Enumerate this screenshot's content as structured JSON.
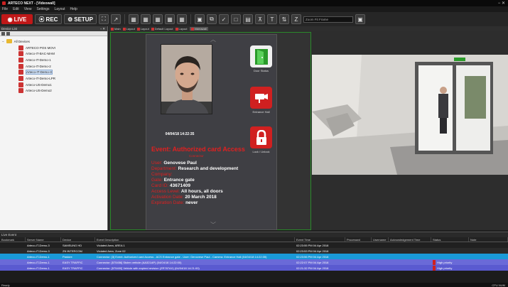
{
  "window": {
    "title": "ARTECO NEXT - [Videowall]",
    "controls": "− ✕"
  },
  "menu": [
    "File",
    "Edit",
    "View",
    "Settings",
    "Layout",
    "Help"
  ],
  "toolbar": {
    "live": "LIVE",
    "rec": "REC",
    "setup": "SETUP",
    "zoom_placeholder": "Zoom Fit Frame"
  },
  "device_list": {
    "title": "Device List",
    "pin": "▫ ✕",
    "root": "All Devices",
    "items": [
      {
        "label": "ARTECO POS MOVI"
      },
      {
        "label": "Arteco-IT-BAC-MAM"
      },
      {
        "label": "Arteco-IT-Demo-1"
      },
      {
        "label": "Arteco-IT-Demo-2"
      },
      {
        "label": "Arteco-IT-Demo-3",
        "selected": true
      },
      {
        "label": "Arteco-IT-Demo-LPR"
      },
      {
        "label": "Arteco-US-Demo1"
      },
      {
        "label": "Arteco-US-Demo2"
      }
    ]
  },
  "tabs": [
    {
      "label": "Main"
    },
    {
      "label": "Layout"
    },
    {
      "label": "Layout"
    },
    {
      "label": "Default Layout"
    },
    {
      "label": "Layout"
    },
    {
      "label": "Videowall",
      "active": true
    }
  ],
  "event_card": {
    "timestamp": "04/04/18 14:22:35",
    "title": "Event: Authorized card Access",
    "subtitle": "Connector",
    "rows": [
      {
        "key": "User:",
        "value": "Genovese Paul"
      },
      {
        "key": "Department:",
        "value": "Research and development"
      },
      {
        "key": "Company:",
        "value": ""
      },
      {
        "key": "Gate:",
        "value": "Entrance gate"
      },
      {
        "key": "Card ID:",
        "value": "43671409"
      },
      {
        "key": "Access Level:",
        "value": "All hours, all doors"
      },
      {
        "key": "Activation Date:",
        "value": "20 March 2018"
      },
      {
        "key": "Expiration Date:",
        "value": "never"
      }
    ],
    "buttons": [
      {
        "label": "Door Status",
        "icon": "door-icon"
      },
      {
        "label": "Entrance Hall",
        "icon": "camera-icon"
      },
      {
        "label": "Lock / Unlock",
        "icon": "lock-icon"
      }
    ]
  },
  "live_event": {
    "title": "Live Event",
    "columns": [
      "Bookmark",
      "Server Name",
      "Device",
      "Event Description",
      "Event Time",
      "Processed",
      "Username",
      "Acknowledgement Time",
      "Status",
      "Note"
    ],
    "rows": [
      {
        "server": "Arteco-IT-Demo-3",
        "device": "SAMSUNG HD",
        "desc": "Violated Area, AREA 1",
        "time": "02:23:55 PM 04 Apr 2018",
        "status": ""
      },
      {
        "server": "Arteco-IT-Demo-3",
        "device": "ZN INTERCOM",
        "desc": "Violated Area, Zone 02",
        "time": "02:23:53 PM 04 Apr 2018",
        "status": ""
      },
      {
        "server": "Arteco-IT-Demo-1",
        "device": "Pastore",
        "desc": "Connector: [3] Event: Authorized card Access - ACS Entrance gate - User: Genovese Paul - Camera: Entrance Hall (04/04/18 14:22:35)",
        "time": "02:23:56 PM 04 Apr 2018",
        "status": ""
      },
      {
        "server": "Arteco-IT-Demo-1",
        "device": "EASY TRAFFIC",
        "desc": "Connector: [575456] Stolen vehicle (AA321AP) (04/04/18 14:22:00)",
        "time": "02:22:07 PM 04 Apr 2018",
        "status": "High priority"
      },
      {
        "server": "Arteco-IT-Demo-1",
        "device": "EASY TRAFFIC",
        "desc": "Connector: [575400] Vehicle with expired revision (ZR787AX) (04/04/18 14:21:00)",
        "time": "02:21:32 PM 04 Apr 2018",
        "status": "High priority"
      }
    ]
  },
  "status": {
    "left": "Ready",
    "right": "CPU NUM"
  }
}
